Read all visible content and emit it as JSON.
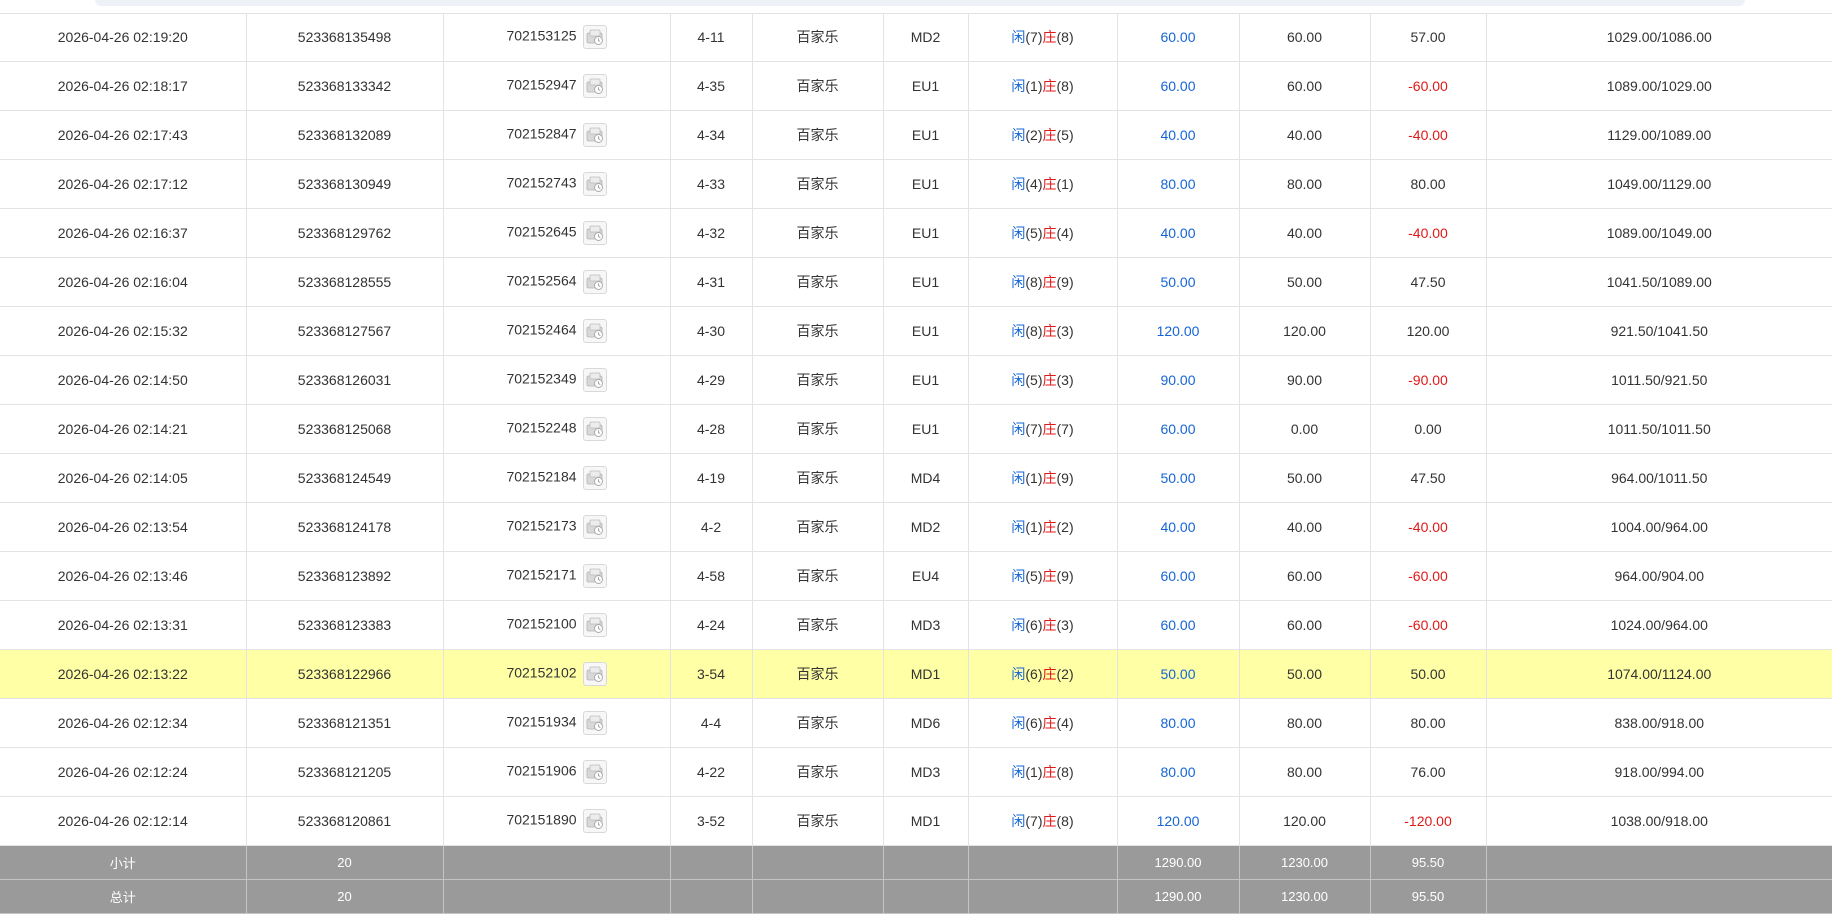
{
  "colors": {
    "player": "#1565d6",
    "banker": "#e01818",
    "loss": "#e01818",
    "highlight_row": "#ffffa5",
    "summary_bg": "#9a9a9a"
  },
  "icons": {
    "draw_icon": "dealer-cards-icon"
  },
  "rows": [
    {
      "time": "2026-04-26 02:19:20",
      "order_no": "523368135498",
      "round_no": "702153125",
      "shoe": "4-11",
      "game": "百家乐",
      "table": "MD2",
      "player_label": "闲",
      "player_pts": "(7)",
      "banker_label": "庄",
      "banker_pts": "(8)",
      "bet": "60.00",
      "valid": "60.00",
      "win": "57.00",
      "win_neg": false,
      "balance": "1029.00/1086.00"
    },
    {
      "time": "2026-04-26 02:18:17",
      "order_no": "523368133342",
      "round_no": "702152947",
      "shoe": "4-35",
      "game": "百家乐",
      "table": "EU1",
      "player_label": "闲",
      "player_pts": "(1)",
      "banker_label": "庄",
      "banker_pts": "(8)",
      "bet": "60.00",
      "valid": "60.00",
      "win": "-60.00",
      "win_neg": true,
      "balance": "1089.00/1029.00"
    },
    {
      "time": "2026-04-26 02:17:43",
      "order_no": "523368132089",
      "round_no": "702152847",
      "shoe": "4-34",
      "game": "百家乐",
      "table": "EU1",
      "player_label": "闲",
      "player_pts": "(2)",
      "banker_label": "庄",
      "banker_pts": "(5)",
      "bet": "40.00",
      "valid": "40.00",
      "win": "-40.00",
      "win_neg": true,
      "balance": "1129.00/1089.00"
    },
    {
      "time": "2026-04-26 02:17:12",
      "order_no": "523368130949",
      "round_no": "702152743",
      "shoe": "4-33",
      "game": "百家乐",
      "table": "EU1",
      "player_label": "闲",
      "player_pts": "(4)",
      "banker_label": "庄",
      "banker_pts": "(1)",
      "bet": "80.00",
      "valid": "80.00",
      "win": "80.00",
      "win_neg": false,
      "balance": "1049.00/1129.00"
    },
    {
      "time": "2026-04-26 02:16:37",
      "order_no": "523368129762",
      "round_no": "702152645",
      "shoe": "4-32",
      "game": "百家乐",
      "table": "EU1",
      "player_label": "闲",
      "player_pts": "(5)",
      "banker_label": "庄",
      "banker_pts": "(4)",
      "bet": "40.00",
      "valid": "40.00",
      "win": "-40.00",
      "win_neg": true,
      "balance": "1089.00/1049.00"
    },
    {
      "time": "2026-04-26 02:16:04",
      "order_no": "523368128555",
      "round_no": "702152564",
      "shoe": "4-31",
      "game": "百家乐",
      "table": "EU1",
      "player_label": "闲",
      "player_pts": "(8)",
      "banker_label": "庄",
      "banker_pts": "(9)",
      "bet": "50.00",
      "valid": "50.00",
      "win": "47.50",
      "win_neg": false,
      "balance": "1041.50/1089.00"
    },
    {
      "time": "2026-04-26 02:15:32",
      "order_no": "523368127567",
      "round_no": "702152464",
      "shoe": "4-30",
      "game": "百家乐",
      "table": "EU1",
      "player_label": "闲",
      "player_pts": "(8)",
      "banker_label": "庄",
      "banker_pts": "(3)",
      "bet": "120.00",
      "valid": "120.00",
      "win": "120.00",
      "win_neg": false,
      "balance": "921.50/1041.50"
    },
    {
      "time": "2026-04-26 02:14:50",
      "order_no": "523368126031",
      "round_no": "702152349",
      "shoe": "4-29",
      "game": "百家乐",
      "table": "EU1",
      "player_label": "闲",
      "player_pts": "(5)",
      "banker_label": "庄",
      "banker_pts": "(3)",
      "bet": "90.00",
      "valid": "90.00",
      "win": "-90.00",
      "win_neg": true,
      "balance": "1011.50/921.50"
    },
    {
      "time": "2026-04-26 02:14:21",
      "order_no": "523368125068",
      "round_no": "702152248",
      "shoe": "4-28",
      "game": "百家乐",
      "table": "EU1",
      "player_label": "闲",
      "player_pts": "(7)",
      "banker_label": "庄",
      "banker_pts": "(7)",
      "bet": "60.00",
      "valid": "0.00",
      "win": "0.00",
      "win_neg": false,
      "balance": "1011.50/1011.50"
    },
    {
      "time": "2026-04-26 02:14:05",
      "order_no": "523368124549",
      "round_no": "702152184",
      "shoe": "4-19",
      "game": "百家乐",
      "table": "MD4",
      "player_label": "闲",
      "player_pts": "(1)",
      "banker_label": "庄",
      "banker_pts": "(9)",
      "bet": "50.00",
      "valid": "50.00",
      "win": "47.50",
      "win_neg": false,
      "balance": "964.00/1011.50"
    },
    {
      "time": "2026-04-26 02:13:54",
      "order_no": "523368124178",
      "round_no": "702152173",
      "shoe": "4-2",
      "game": "百家乐",
      "table": "MD2",
      "player_label": "闲",
      "player_pts": "(1)",
      "banker_label": "庄",
      "banker_pts": "(2)",
      "bet": "40.00",
      "valid": "40.00",
      "win": "-40.00",
      "win_neg": true,
      "balance": "1004.00/964.00"
    },
    {
      "time": "2026-04-26 02:13:46",
      "order_no": "523368123892",
      "round_no": "702152171",
      "shoe": "4-58",
      "game": "百家乐",
      "table": "EU4",
      "player_label": "闲",
      "player_pts": "(5)",
      "banker_label": "庄",
      "banker_pts": "(9)",
      "bet": "60.00",
      "valid": "60.00",
      "win": "-60.00",
      "win_neg": true,
      "balance": "964.00/904.00"
    },
    {
      "time": "2026-04-26 02:13:31",
      "order_no": "523368123383",
      "round_no": "702152100",
      "shoe": "4-24",
      "game": "百家乐",
      "table": "MD3",
      "player_label": "闲",
      "player_pts": "(6)",
      "banker_label": "庄",
      "banker_pts": "(3)",
      "bet": "60.00",
      "valid": "60.00",
      "win": "-60.00",
      "win_neg": true,
      "balance": "1024.00/964.00"
    },
    {
      "time": "2026-04-26 02:13:22",
      "order_no": "523368122966",
      "round_no": "702152102",
      "shoe": "3-54",
      "game": "百家乐",
      "table": "MD1",
      "player_label": "闲",
      "player_pts": "(6)",
      "banker_label": "庄",
      "banker_pts": "(2)",
      "bet": "50.00",
      "valid": "50.00",
      "win": "50.00",
      "win_neg": false,
      "balance": "1074.00/1124.00",
      "highlight": true
    },
    {
      "time": "2026-04-26 02:12:34",
      "order_no": "523368121351",
      "round_no": "702151934",
      "shoe": "4-4",
      "game": "百家乐",
      "table": "MD6",
      "player_label": "闲",
      "player_pts": "(6)",
      "banker_label": "庄",
      "banker_pts": "(4)",
      "bet": "80.00",
      "valid": "80.00",
      "win": "80.00",
      "win_neg": false,
      "balance": "838.00/918.00"
    },
    {
      "time": "2026-04-26 02:12:24",
      "order_no": "523368121205",
      "round_no": "702151906",
      "shoe": "4-22",
      "game": "百家乐",
      "table": "MD3",
      "player_label": "闲",
      "player_pts": "(1)",
      "banker_label": "庄",
      "banker_pts": "(8)",
      "bet": "80.00",
      "valid": "80.00",
      "win": "76.00",
      "win_neg": false,
      "balance": "918.00/994.00"
    },
    {
      "time": "2026-04-26 02:12:14",
      "order_no": "523368120861",
      "round_no": "702151890",
      "shoe": "3-52",
      "game": "百家乐",
      "table": "MD1",
      "player_label": "闲",
      "player_pts": "(7)",
      "banker_label": "庄",
      "banker_pts": "(8)",
      "bet": "120.00",
      "valid": "120.00",
      "win": "-120.00",
      "win_neg": true,
      "balance": "1038.00/918.00"
    }
  ],
  "summary": {
    "subtotal": {
      "label": "小计",
      "count": "20",
      "bet": "1290.00",
      "valid": "1230.00",
      "win": "95.50"
    },
    "total": {
      "label": "总计",
      "count": "20",
      "bet": "1290.00",
      "valid": "1230.00",
      "win": "95.50"
    }
  }
}
